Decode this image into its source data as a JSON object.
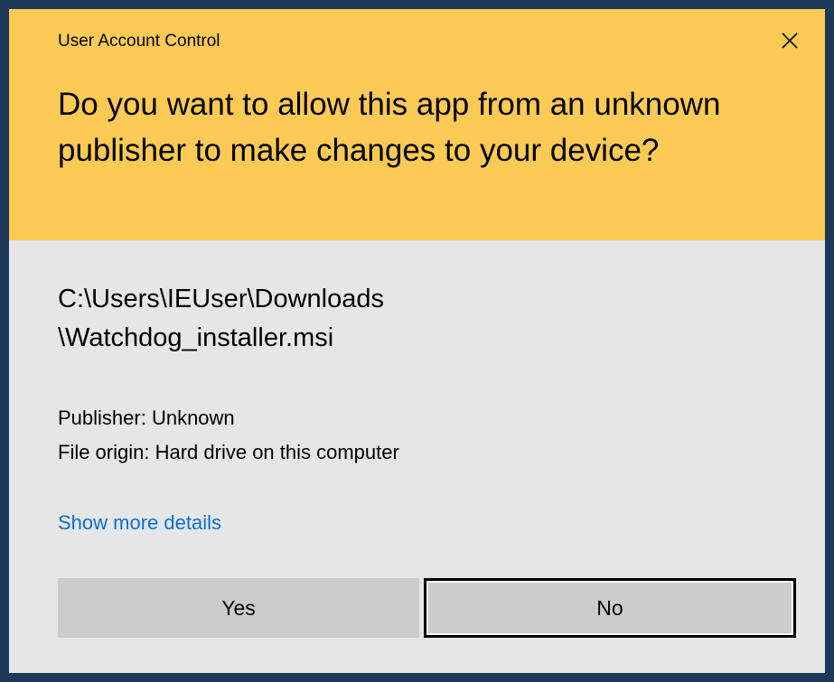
{
  "dialog": {
    "caption": "User Account Control",
    "question": "Do you want to allow this app from an unknown publisher to make changes to your device?",
    "path_line1": "C:\\Users\\IEUser\\Downloads",
    "path_line2": "\\Watchdog_installer.msi",
    "publisher": "Publisher: Unknown",
    "file_origin": "File origin: Hard drive on this computer",
    "details_link": "Show more details",
    "yes_label": "Yes",
    "no_label": "No",
    "close_icon": "close-icon"
  },
  "colors": {
    "header_background": "#fcca55",
    "body_background": "#e6e6e6",
    "link": "#0a6ed1",
    "button": "#cccccc",
    "border": "#1e3859"
  }
}
